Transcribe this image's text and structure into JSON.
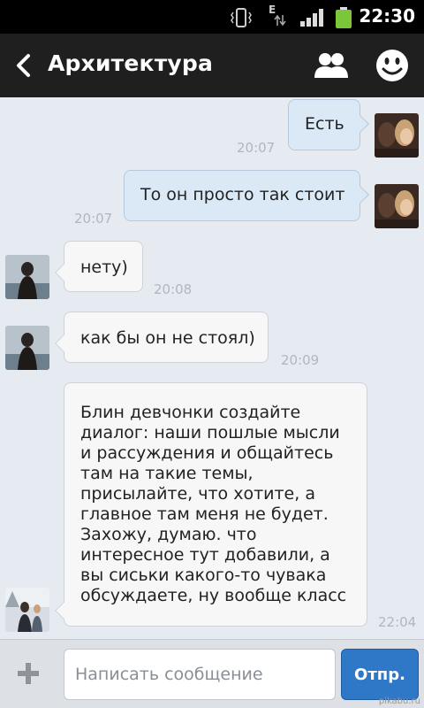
{
  "status_bar": {
    "data_indicator": "E",
    "time": "22:30",
    "icons": [
      "vibrate-icon",
      "data-arrows-icon",
      "signal-bars-icon",
      "battery-icon"
    ],
    "battery_color": "#7cc63a"
  },
  "header": {
    "title": "Архитектура",
    "icons": [
      "back-arrow-icon",
      "members-icon",
      "smiley-icon"
    ]
  },
  "messages": [
    {
      "direction": "out",
      "text": "Есть",
      "time": "20:07"
    },
    {
      "direction": "out",
      "text": "То он просто так стоит",
      "time": "20:07"
    },
    {
      "direction": "in",
      "text": "нету)",
      "time": "20:08"
    },
    {
      "direction": "in",
      "text": "как бы он не стоял)",
      "time": "20:09"
    },
    {
      "direction": "in",
      "text": "Блин девчонки создайте диалог: наши пошлые мысли и рассуждения и общайтесь там на такие темы, присылайте, что хотите, а главное там меня не будет. Захожу, думаю. что интересное тут добавили, а вы сиськи какого-то чувака обсуждаете, ну вообще класс",
      "time": "22:04"
    }
  ],
  "composer": {
    "placeholder": "Написать сообщение",
    "send_label": "Отпр."
  },
  "watermark": "pikabu.ru",
  "colors": {
    "chat_background": "#e6ebf1",
    "outgoing_bubble": "#dbe9f7",
    "incoming_bubble": "#f7f7f7",
    "send_button": "#2f78c7",
    "action_bar": "#1f1f1f"
  }
}
